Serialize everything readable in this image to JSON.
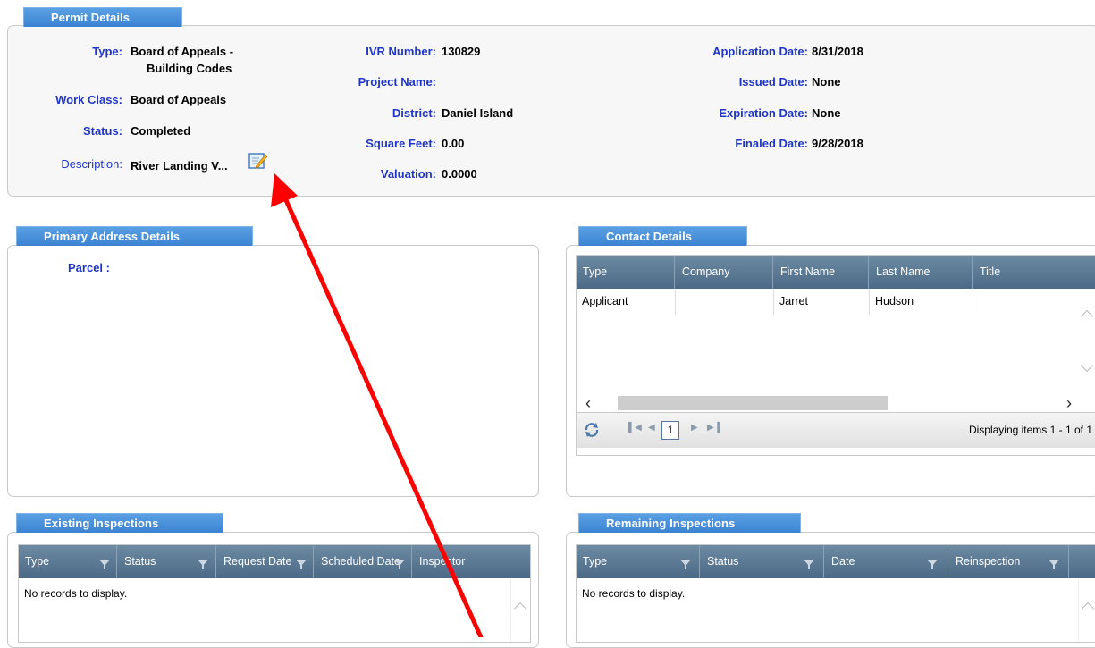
{
  "permit": {
    "tab": "Permit Details",
    "type_label": "Type:",
    "type_value_1": "Board of Appeals -",
    "type_value_2": "Building Codes",
    "work_class_label": "Work Class:",
    "work_class_value": "Board of Appeals",
    "status_label": "Status:",
    "status_value": "Completed",
    "description_label": "Description:",
    "description_value": "River Landing V...",
    "ivr_label": "IVR Number:",
    "ivr_value": "130829",
    "project_name_label": "Project Name:",
    "project_name_value": "",
    "district_label": "District:",
    "district_value": "Daniel Island",
    "square_feet_label": "Square Feet:",
    "square_feet_value": "0.00",
    "valuation_label": "Valuation:",
    "valuation_value": "0.0000",
    "application_date_label": "Application Date:",
    "application_date_value": "8/31/2018",
    "issued_date_label": "Issued Date:",
    "issued_date_value": "None",
    "expiration_date_label": "Expiration Date:",
    "expiration_date_value": "None",
    "finaled_date_label": "Finaled Date:",
    "finaled_date_value": "9/28/2018"
  },
  "address": {
    "tab": "Primary Address Details",
    "parcel_label": "Parcel :"
  },
  "contacts": {
    "tab": "Contact Details",
    "columns": [
      "Type",
      "Company",
      "First Name",
      "Last Name",
      "Title"
    ],
    "rows": [
      [
        "Applicant",
        "",
        "Jarret",
        "Hudson",
        ""
      ]
    ],
    "page_number": "1",
    "paging_text": "Displaying items 1 - 1 of 1"
  },
  "existing": {
    "tab": "Existing Inspections",
    "columns": [
      "Type",
      "Status",
      "Request Date",
      "Scheduled Date",
      "Inspector"
    ],
    "empty_text": "No records to display."
  },
  "remaining": {
    "tab": "Remaining Inspections",
    "columns": [
      "Type",
      "Status",
      "Date",
      "Reinspection"
    ],
    "empty_text": "No records to display."
  },
  "colors": {
    "label_blue": "#1f35c8",
    "tab_blue": "#3b83d2",
    "grid_header": "#4c6a86",
    "arrow_red": "#ff0000"
  },
  "icons": [
    "edit-note-icon",
    "refresh-icon",
    "first-page-icon",
    "prev-page-icon",
    "next-page-icon",
    "last-page-icon",
    "filter-icon",
    "chevron-up-icon",
    "chevron-down-icon",
    "chevron-left-icon",
    "chevron-right-icon"
  ]
}
